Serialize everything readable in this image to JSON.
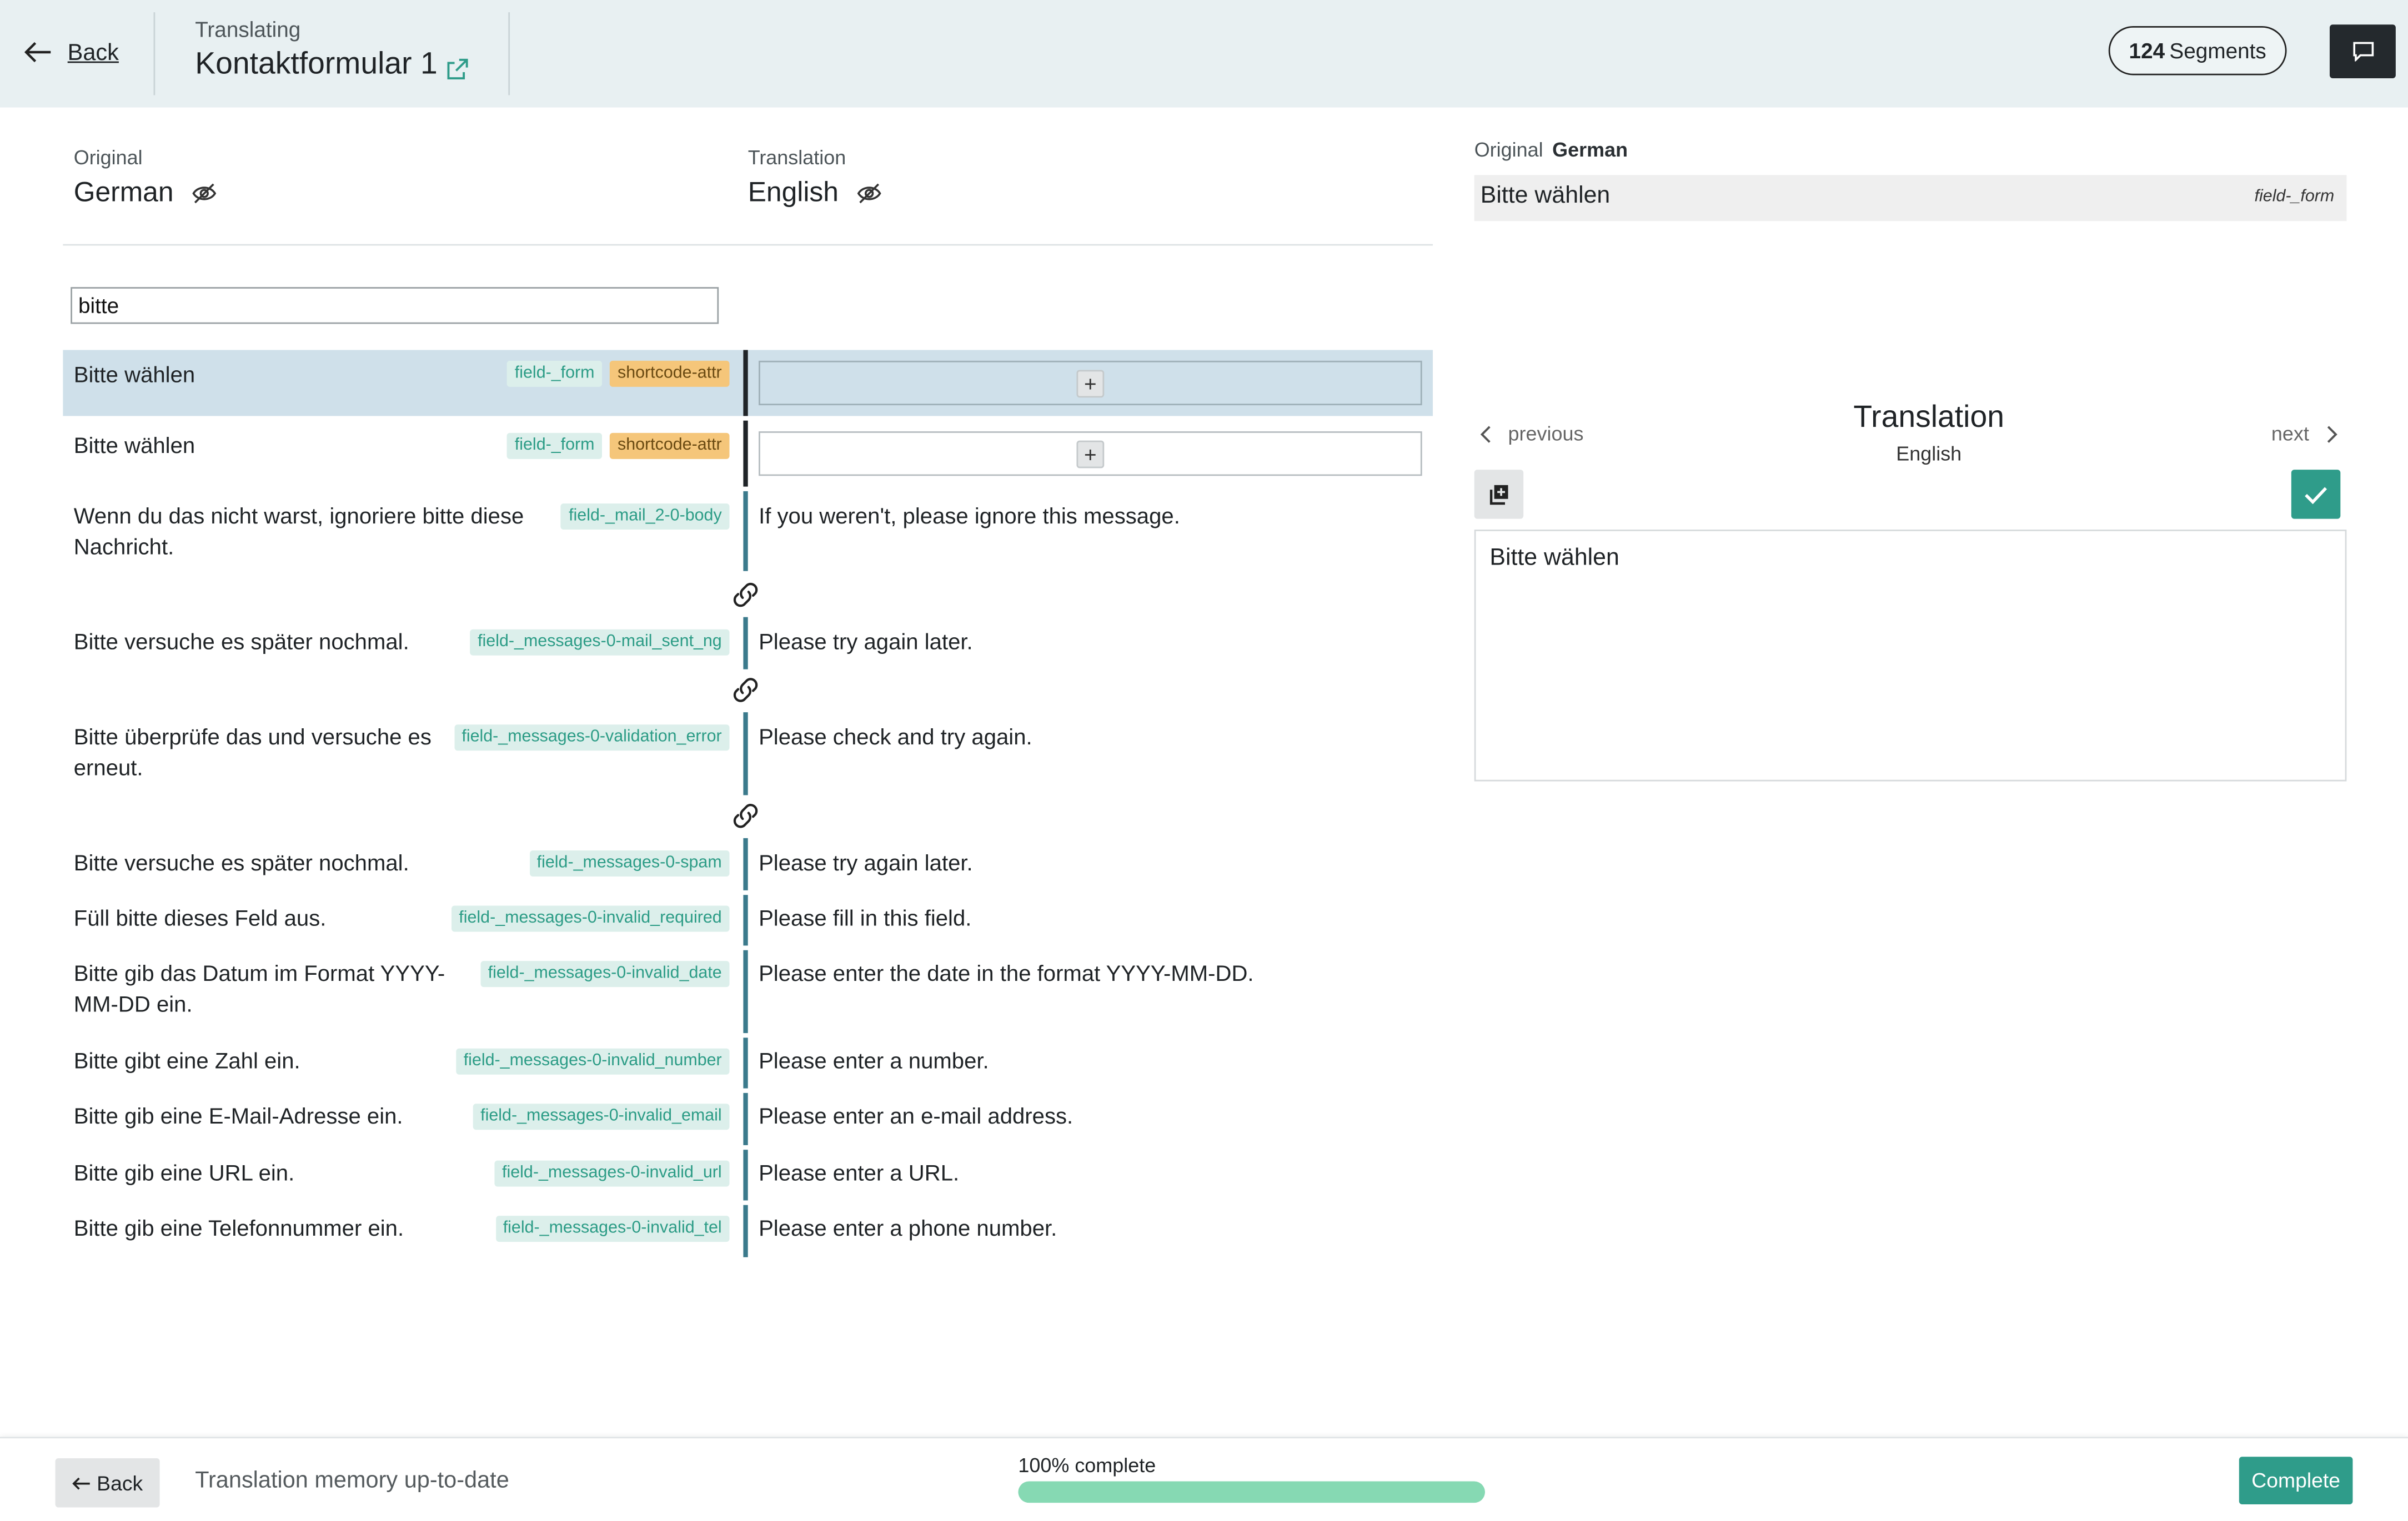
{
  "header": {
    "back_label": "Back",
    "subtitle": "Translating",
    "title": "Kontaktformular 1",
    "segments_count": "124",
    "segments_label": "Segments"
  },
  "columns": {
    "original_label": "Original",
    "original_language": "German",
    "translation_label": "Translation",
    "translation_language": "English"
  },
  "search": {
    "value": "bitte",
    "placeholder": ""
  },
  "segments": [
    {
      "source": "Bitte wählen",
      "tags": [
        "field-_form",
        "shortcode-attr"
      ],
      "target": "",
      "selected": true
    },
    {
      "source": "Bitte wählen",
      "tags": [
        "field-_form",
        "shortcode-attr"
      ],
      "target": ""
    },
    {
      "source": "Wenn du das nicht warst, ignoriere bitte diese Nachricht.",
      "tags": [
        "field-_mail_2-0-body"
      ],
      "target": "If you weren't, please ignore this message."
    },
    {
      "source": "Bitte versuche es später nochmal.",
      "tags": [
        "field-_messages-0-mail_sent_ng"
      ],
      "target": "Please try again later."
    },
    {
      "source": "Bitte überprüfe das und versuche es erneut.",
      "tags": [
        "field-_messages-0-validation_error"
      ],
      "target": "Please check and try again."
    },
    {
      "source": "Bitte versuche es später nochmal.",
      "tags": [
        "field-_messages-0-spam"
      ],
      "target": "Please try again later."
    },
    {
      "source": "Füll bitte dieses Feld aus.",
      "tags": [
        "field-_messages-0-invalid_required"
      ],
      "target": "Please fill in this field."
    },
    {
      "source": "Bitte gib das Datum im Format YYYY-MM-DD ein.",
      "tags": [
        "field-_messages-0-invalid_date"
      ],
      "target": "Please enter the date in the format YYYY-MM-DD."
    },
    {
      "source": "Bitte gibt eine Zahl ein.",
      "tags": [
        "field-_messages-0-invalid_number"
      ],
      "target": "Please enter a number."
    },
    {
      "source": "Bitte gib eine E-Mail-Adresse ein.",
      "tags": [
        "field-_messages-0-invalid_email"
      ],
      "target": "Please enter an e-mail address."
    },
    {
      "source": "Bitte gib eine URL ein.",
      "tags": [
        "field-_messages-0-invalid_url"
      ],
      "target": "Please enter a URL."
    },
    {
      "source": "Bitte gib eine Telefonnummer ein.",
      "tags": [
        "field-_messages-0-invalid_tel"
      ],
      "target": "Please enter a phone number."
    }
  ],
  "add_translation_glyph": "+",
  "editor": {
    "original_label": "Original",
    "original_language": "German",
    "source_text": "Bitte wählen",
    "source_field": "field-_form",
    "previous_label": "previous",
    "next_label": "next",
    "title": "Translation",
    "language": "English",
    "translation_value": "Bitte wählen"
  },
  "footer": {
    "back_label": "Back",
    "tm_status": "Translation memory up-to-date",
    "progress_label": "100% complete",
    "progress_value": 1.0,
    "complete_label": "Complete"
  },
  "colors": {
    "accent": "#2f9c8a",
    "header_bg": "#e8f0f2",
    "selected_row": "#cfe0ea",
    "tag_teal_bg": "#dcefeb",
    "tag_orange_bg": "#f5c67a",
    "progress_fill": "#86d9b3"
  },
  "icons": {
    "back": "arrow-left-icon",
    "external": "external-link-icon",
    "comment": "comment-icon",
    "visibility": "eye-slash-icon",
    "link": "chain-link-icon",
    "copy": "copy-icon",
    "check": "check-icon"
  }
}
